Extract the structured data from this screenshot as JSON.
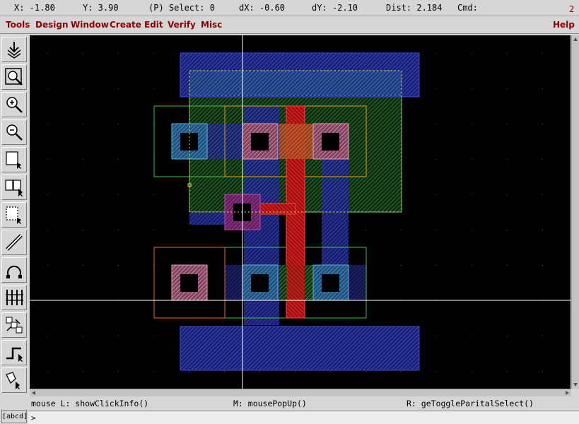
{
  "status": {
    "x": "X: -1.80",
    "y": "Y: 3.90",
    "select": "(P) Select: 0",
    "dx": "dX: -0.60",
    "dy": "dY: -2.10",
    "dist": "Dist: 2.184",
    "cmd": "Cmd:",
    "window_number": "2"
  },
  "menu": {
    "items": [
      "Tools",
      "Design",
      "Window",
      "Create",
      "Edit",
      "Verify",
      "Misc"
    ],
    "help": "Help"
  },
  "colors": {
    "menu_text": "#8a0000",
    "canvas_bg": "#000000",
    "metal1": "#3a4ad0",
    "poly": "#e02020",
    "diffusion": "#40b040",
    "nwell_outline": "#40c040",
    "select_outline": "#e08000",
    "contact_fill": "#d8a0b0",
    "crosshair": "#ffffff"
  },
  "toolbar": {
    "icons": [
      "select-all-icon",
      "zoom-fit-icon",
      "zoom-in-icon",
      "zoom-out-icon",
      "select-area-icon",
      "select-multiple-icon",
      "select-partial-icon",
      "ruler-icon",
      "undo-arc-icon",
      "grid-ruler-icon",
      "stretch-icon",
      "path-icon",
      "polygon-icon"
    ],
    "abcd_label": "[abcd]"
  },
  "mouse_help": {
    "left": "mouse L: showClickInfo()",
    "middle": "M: mousePopUp()",
    "right": "R: geToggleParitalSelect()"
  },
  "command_line": {
    "prompt": ">"
  }
}
